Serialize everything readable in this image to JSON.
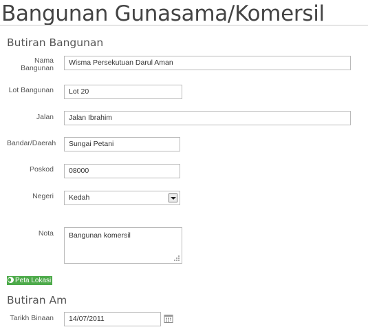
{
  "page": {
    "title": "Bangunan Gunasama/Komersil"
  },
  "sections": {
    "butiran_bangunan": "Butiran Bangunan",
    "butiran_am": "Butiran Am"
  },
  "fields": {
    "nama_bangunan": {
      "label_line1": "Nama",
      "label_line2": "Bangunan",
      "value": "Wisma Persekutuan Darul Aman"
    },
    "lot_bangunan": {
      "label": "Lot Bangunan",
      "value": "Lot 20"
    },
    "jalan": {
      "label": "Jalan",
      "value": "Jalan Ibrahim"
    },
    "bandar_daerah": {
      "label": "Bandar/Daerah",
      "value": "Sungai Petani"
    },
    "poskod": {
      "label": "Poskod",
      "value": "08000"
    },
    "negeri": {
      "label": "Negeri",
      "value": "Kedah"
    },
    "nota": {
      "label": "Nota",
      "value": "Bangunan komersil"
    },
    "tarikh_binaan": {
      "label": "Tarikh Binaan",
      "value": "14/07/2011"
    }
  },
  "peta_lokasi": {
    "label": "Peta Lokasi",
    "icon": "globe-icon",
    "color": "#4daa4a"
  },
  "icons": {
    "dropdown": "chevron-down-icon",
    "calendar": "calendar-icon",
    "resize": "resize-grip-icon"
  }
}
